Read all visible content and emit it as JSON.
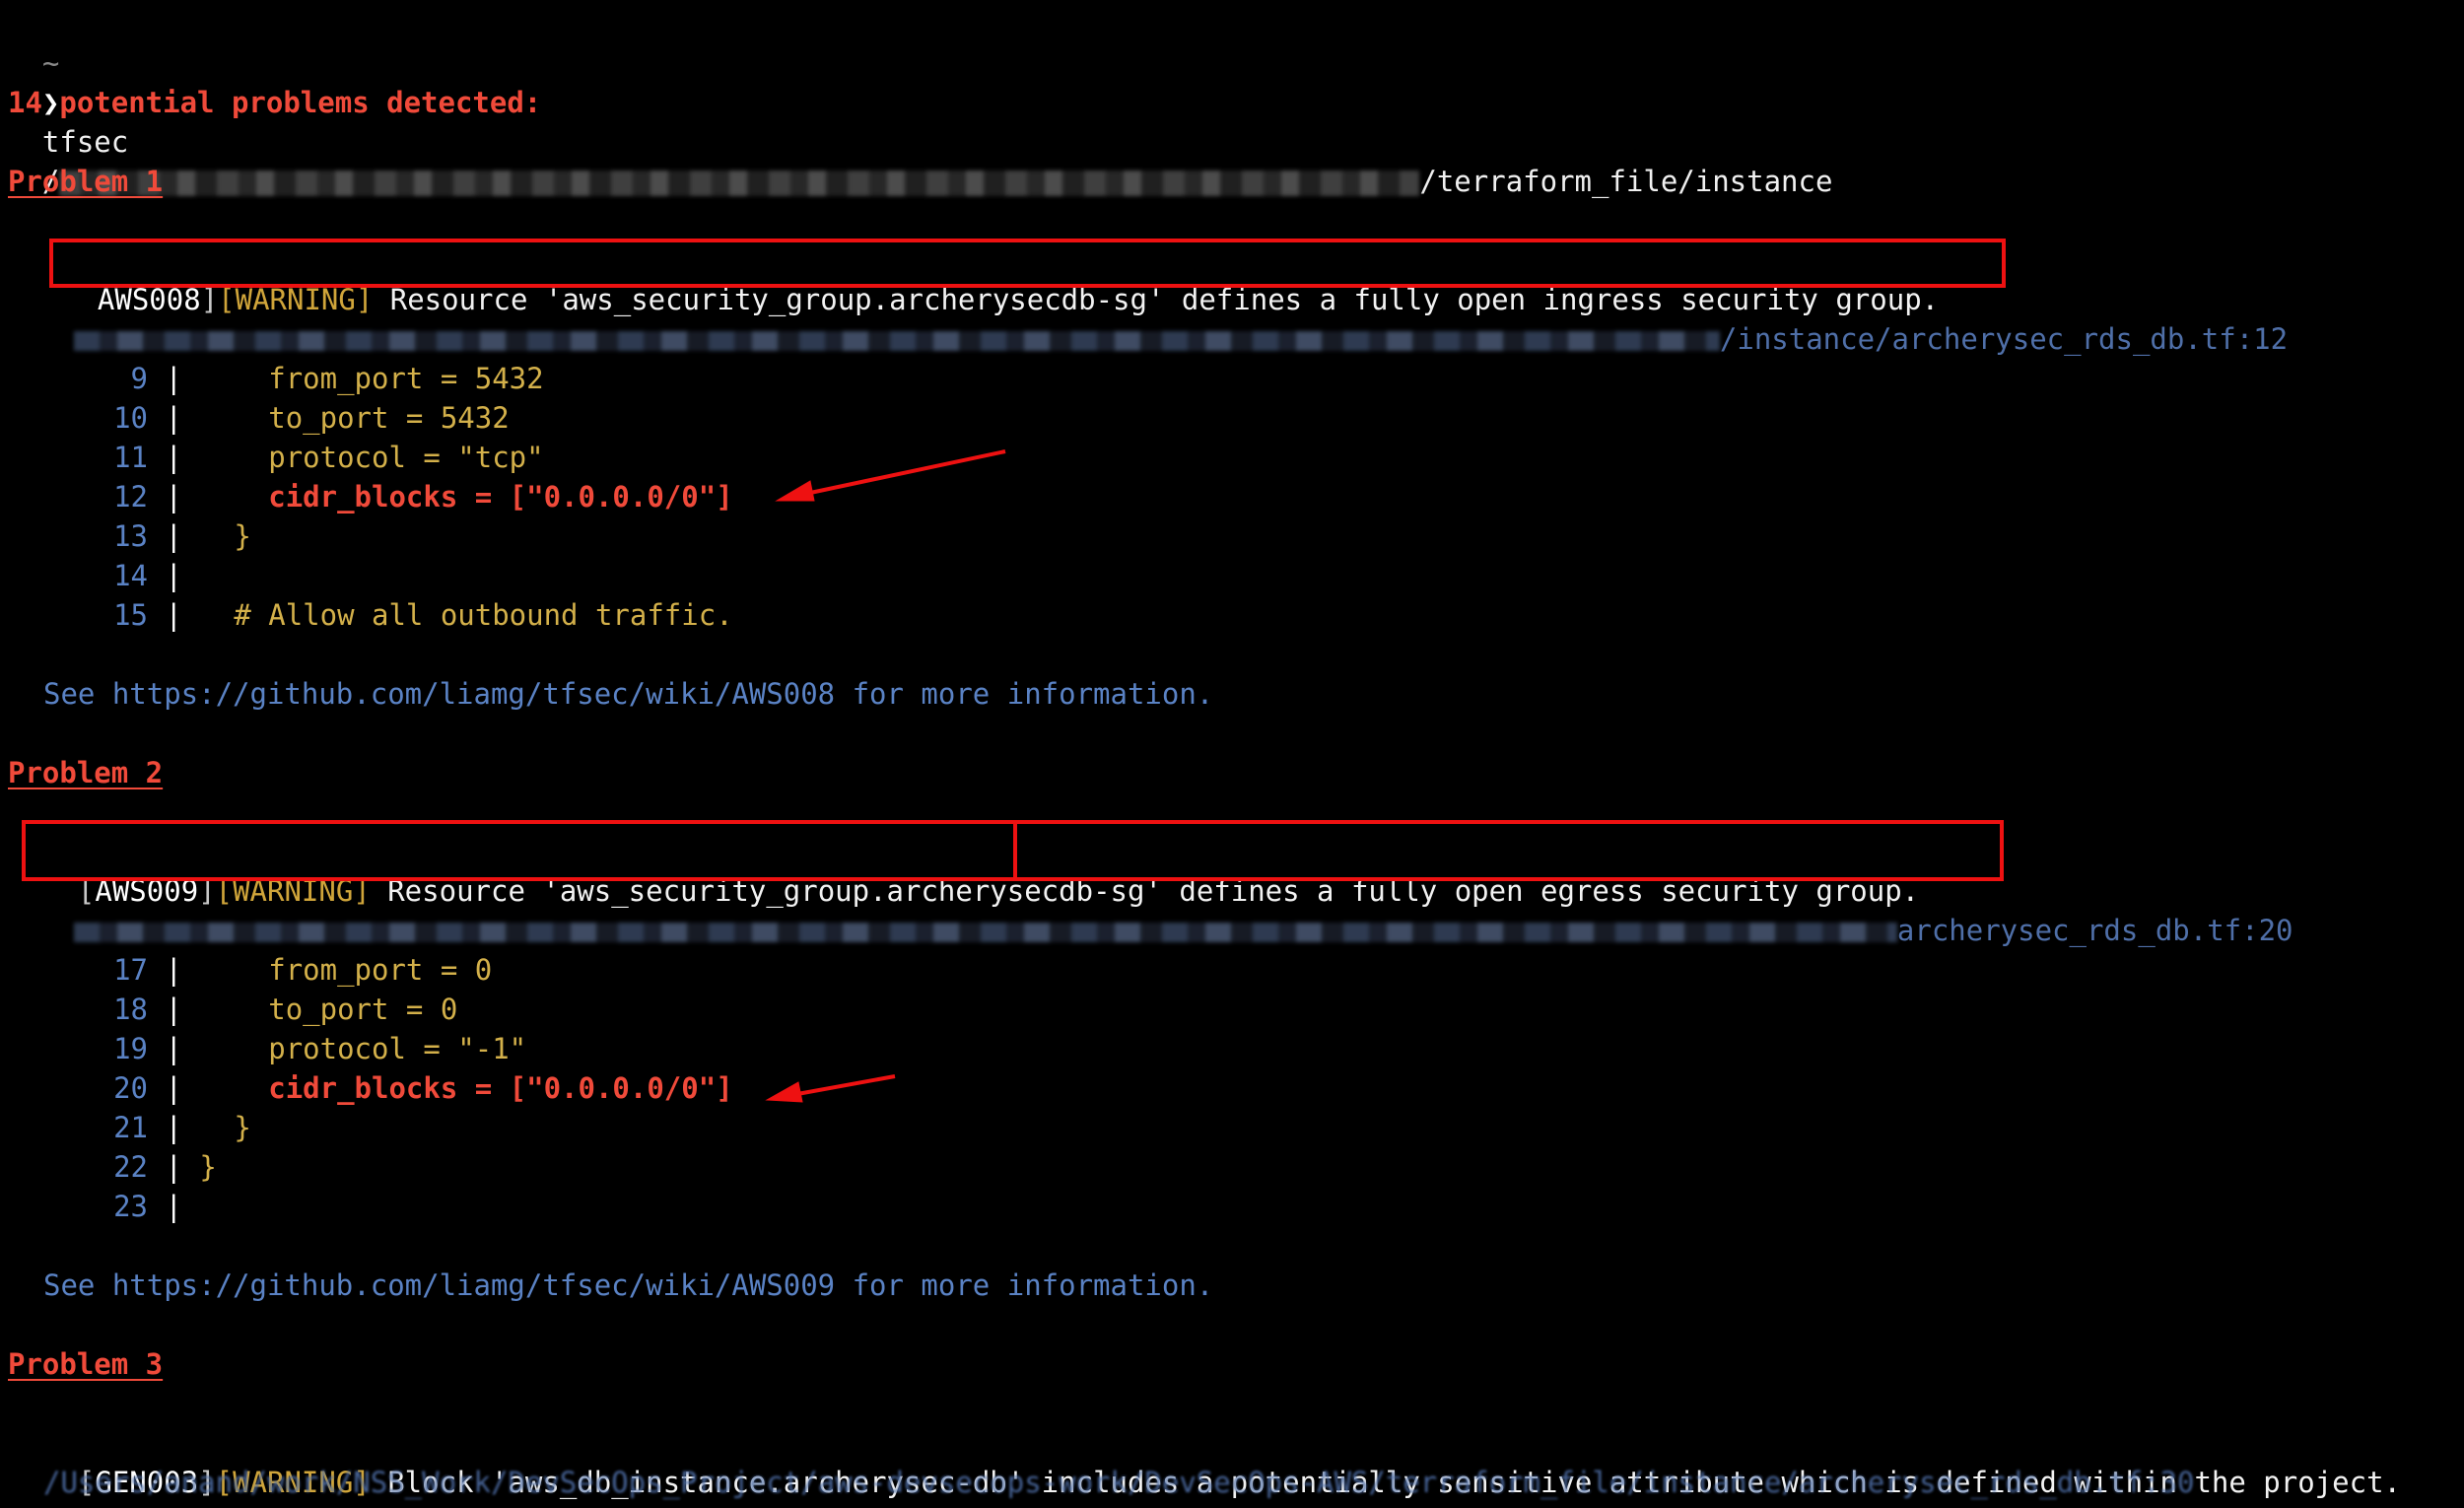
{
  "prompt": {
    "tilde": "~",
    "chevron": "❯",
    "command": "tfsec",
    "path_prefix": "/",
    "path_suffix": "/terraform_file/instance"
  },
  "summary": "14 potential problems detected:",
  "problems": [
    {
      "heading": "Problem 1",
      "open_bracket": "",
      "rule_id": "AWS008",
      "severity": "[WARNING]",
      "message": " Resource 'aws_security_group.archerysecdb-sg' defines a fully open ingress security group.",
      "location": "/instance/archerysec_rds_db.tf:12",
      "lines": [
        {
          "num": "9",
          "text": "    from_port = 5432",
          "highlight": false
        },
        {
          "num": "10",
          "text": "    to_port = 5432",
          "highlight": false
        },
        {
          "num": "11",
          "text": "    protocol = \"tcp\"",
          "highlight": false
        },
        {
          "num": "12",
          "text": "    cidr_blocks = [\"0.0.0.0/0\"]",
          "highlight": true
        },
        {
          "num": "13",
          "text": "  }",
          "highlight": false
        },
        {
          "num": "14",
          "text": "",
          "highlight": false
        },
        {
          "num": "15",
          "text": "  # Allow all outbound traffic.",
          "highlight": false
        }
      ],
      "see_text": "See https://github.com/liamg/tfsec/wiki/AWS008 for more information."
    },
    {
      "heading": "Problem 2",
      "open_bracket": "[",
      "rule_id": "AWS009",
      "severity": "[WARNING]",
      "message": " Resource 'aws_security_group.archerysecdb-sg' defines a fully open egress security group.",
      "location": "archerysec_rds_db.tf:20",
      "lines": [
        {
          "num": "17",
          "text": "    from_port = 0",
          "highlight": false
        },
        {
          "num": "18",
          "text": "    to_port = 0",
          "highlight": false
        },
        {
          "num": "19",
          "text": "    protocol = \"-1\"",
          "highlight": false
        },
        {
          "num": "20",
          "text": "    cidr_blocks = [\"0.0.0.0/0\"]",
          "highlight": true
        },
        {
          "num": "21",
          "text": "  }",
          "highlight": false
        },
        {
          "num": "22",
          "text": "}",
          "highlight": false
        },
        {
          "num": "23",
          "text": "",
          "highlight": false
        }
      ],
      "see_text": "See https://github.com/liamg/tfsec/wiki/AWS009 for more information."
    },
    {
      "heading": "Problem 3",
      "open_bracket": "[",
      "rule_id": "GEN003",
      "severity": "[WARNING]",
      "message": " Block 'aws_db_instance.archerysec-db' includes a potentially sensitive attribute which is defined within the project.",
      "location": "/Users/anand/work/NSS_Work/DevSecOps_Project/aws-devsecops-work/DevSecOps-AWS/terraform_file/instance/archerysec_rds_db.tf:30"
    }
  ],
  "colors": {
    "background": "#000000",
    "error_red": "#f04a3a",
    "warning_yellow": "#d0a53a",
    "link_blue": "#5a82c4",
    "annotation_red": "#ee1111"
  }
}
